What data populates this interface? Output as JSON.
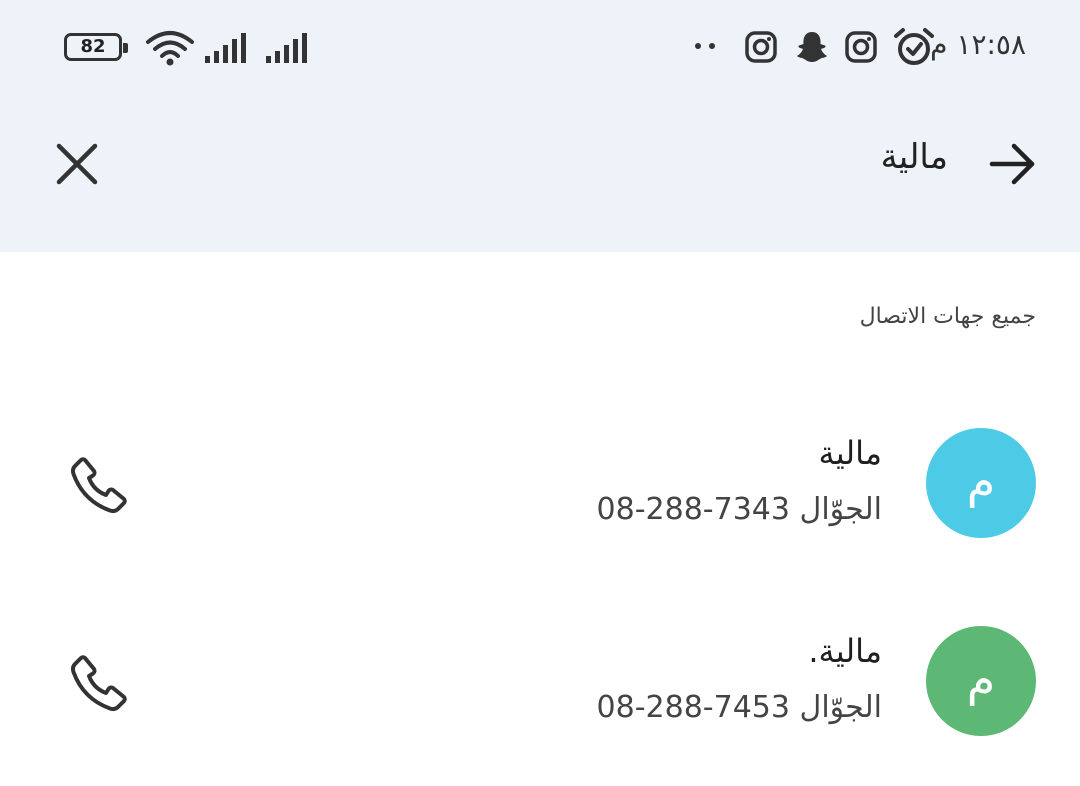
{
  "status_bar": {
    "battery_level": "82",
    "time": "١٢:٥٨ م",
    "icons": [
      "battery-icon",
      "wifi-icon",
      "signal-icon",
      "signal-icon",
      "more-dots-icon",
      "instagram-icon",
      "snapchat-icon",
      "instagram-icon",
      "alarm-icon"
    ]
  },
  "search_bar": {
    "query": "مالية",
    "close_icon": "close-icon",
    "back_icon": "arrow-right-icon"
  },
  "section": {
    "label": "جميع جهات الاتصال"
  },
  "contacts": [
    {
      "initial": "م",
      "name": "مالية",
      "type": "الجوّال",
      "number": "08-288-7343",
      "avatar_color": "#4dcbe6"
    },
    {
      "initial": "م",
      "name": "مالية.",
      "type": "الجوّال",
      "number": "08-288-7453",
      "avatar_color": "#5cb874"
    }
  ],
  "colors": {
    "header_bg": "#eef3f9",
    "icon": "#333333"
  }
}
